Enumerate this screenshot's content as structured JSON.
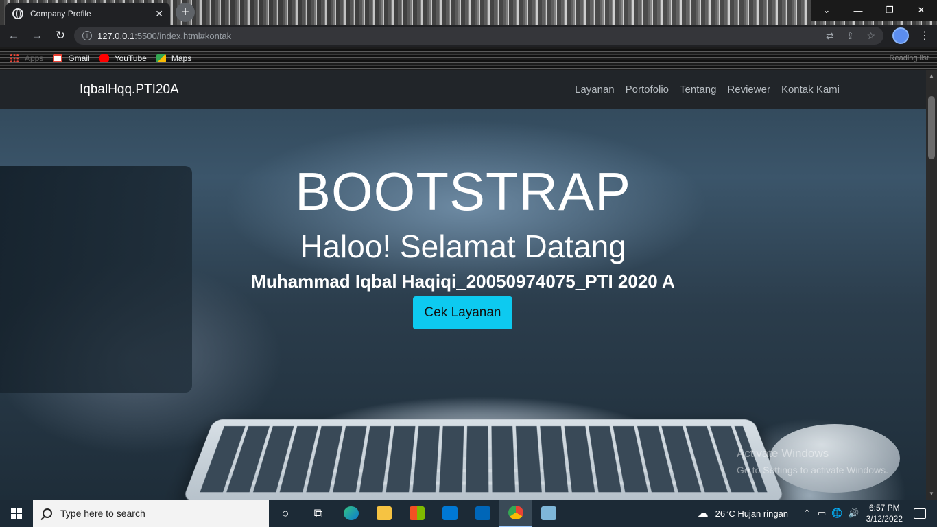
{
  "browser": {
    "tab_title": "Company Profile",
    "tab_close": "✕",
    "new_tab": "+",
    "url_host": "127.0.0.1",
    "url_rest": ":5500/index.html#kontak",
    "bookmarks": [
      "Apps",
      "Gmail",
      "YouTube",
      "Maps"
    ],
    "reading_list": "Reading list"
  },
  "site": {
    "brand": "IqbalHqq.PTI20A",
    "nav": [
      "Layanan",
      "Portofolio",
      "Tentang",
      "Reviewer",
      "Kontak Kami"
    ],
    "hero_title": "BOOTSTRAP",
    "hero_subtitle": "Haloo! Selamat Datang",
    "hero_name": "Muhammad Iqbal Haqiqi_20050974075_PTI 2020 A",
    "cta_label": "Cek Layanan"
  },
  "watermark": {
    "line1": "Activate Windows",
    "line2": "Go to Settings to activate Windows."
  },
  "taskbar": {
    "search_placeholder": "Type here to search",
    "weather": "26°C  Hujan ringan",
    "time": "6:57 PM",
    "date": "3/12/2022"
  },
  "colors": {
    "cta": "#0dcaf0",
    "navbar": "#212529"
  }
}
